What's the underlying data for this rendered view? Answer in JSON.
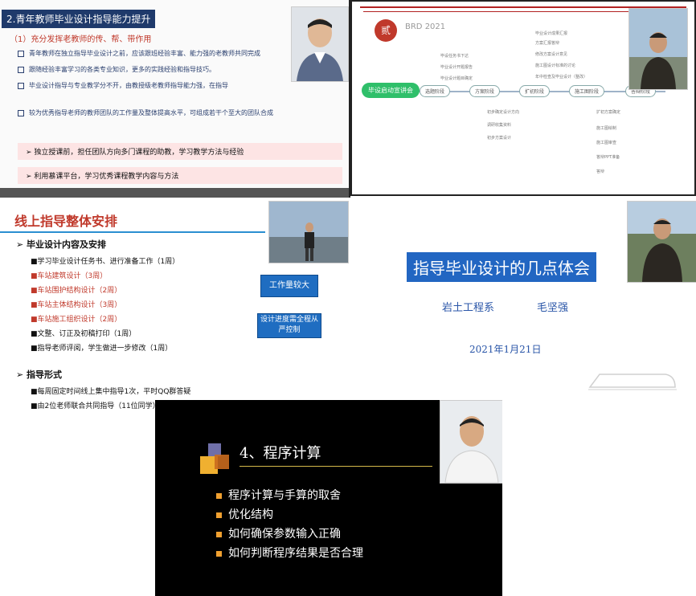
{
  "panel1": {
    "title": "2.青年教师毕业设计指导能力提升",
    "subtitle": "（1）充分发挥老教师的传、帮、带作用",
    "bullets": [
      "青年教师在独立指导毕业设计之前，应该跟班经验丰富、能力强的老教师共同完成",
      "跟随经验丰富学习的各类专业知识，更多的实践经验和指导技巧。",
      "毕业设计指导与专业教学分不开，由教授级老教师指导能力强，在指导",
      "较为优秀指导老师的教师团队的工作量及整体提高水平，可组成若干个至大的团队合成"
    ],
    "highlights": [
      "➢ 独立授课前，担任团队方向多门课程的助教，学习教学方法与经验",
      "➢ 利用慕课平台，学习优秀课程教学内容与方法"
    ]
  },
  "panel2": {
    "chip": "贰",
    "brd": "BRD 2021",
    "start": "毕设启动宣讲会",
    "nodes": [
      "选题阶段",
      "方案阶段",
      "扩初阶段",
      "施工图阶段",
      "答辩阶段"
    ],
    "leaves_top": [
      "毕设任务书下达",
      "毕业设计开题报告",
      "毕业设计题目确定",
      "方案汇报答辩",
      "修改方案设计意见",
      "施工图设计标准的讨论",
      "年中检查及毕业设计（整改）",
      "毕业设计成果汇报"
    ],
    "leaves_bottom": [
      "初步确定设计方向",
      "调研收集资料",
      "初步方案设计",
      "扩初方案确定",
      "施工图绘制",
      "施工图审查",
      "答辩PPT准备",
      "答辩"
    ]
  },
  "panel3": {
    "title": "线上指导整体安排",
    "section1": "➢  毕业设计内容及安排",
    "items": [
      {
        "text": "■学习毕业设计任务书、进行准备工作（1周）",
        "color": "#111111"
      },
      {
        "text": "■车站建筑设计（3周）",
        "color": "#c0392b"
      },
      {
        "text": "■车站围护结构设计（2周）",
        "color": "#c0392b"
      },
      {
        "text": "■车站主体结构设计（3周）",
        "color": "#c0392b"
      },
      {
        "text": "■车站施工组织设计（2周）",
        "color": "#c0392b"
      },
      {
        "text": "■文整、订正及初稿打印（1周）",
        "color": "#111111"
      },
      {
        "text": "■指导老师评阅，学生做进一步修改（1周）",
        "color": "#111111"
      }
    ],
    "section2": "➢  指导形式",
    "items2": [
      {
        "text": "■每周固定时间线上集中指导1次，平时QQ群答疑",
        "color": "#111111"
      },
      {
        "text": "■由2位老师联合共同指导（11位同学）",
        "color": "#111111"
      }
    ],
    "button1": "工作量较大",
    "button2": "设计进度需全程从严控制"
  },
  "panel4": {
    "title": "指导毕业设计的几点体会",
    "dept": "岩土工程系",
    "author": "毛坚强",
    "date": "2021年1月21日"
  },
  "panel5": {
    "title": "4、程序计算",
    "items": [
      "程序计算与手算的取舍",
      "优化结构",
      "如何确保参数输入正确",
      "如何判断程序结果是否合理"
    ]
  }
}
